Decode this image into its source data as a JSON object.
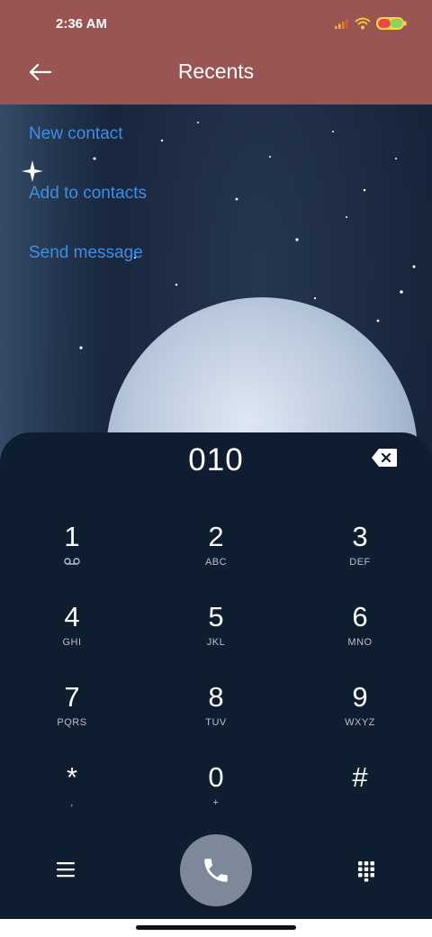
{
  "status_bar": {
    "time": "2:36 AM"
  },
  "header": {
    "title": "Recents",
    "back_icon": "arrow-left-icon"
  },
  "actions": [
    {
      "label": "New contact"
    },
    {
      "label": "Add to contacts"
    },
    {
      "label": "Send message"
    }
  ],
  "dialer": {
    "number": "010",
    "keys": [
      {
        "digit": "1",
        "letters": ""
      },
      {
        "digit": "2",
        "letters": "ABC"
      },
      {
        "digit": "3",
        "letters": "DEF"
      },
      {
        "digit": "4",
        "letters": "GHI"
      },
      {
        "digit": "5",
        "letters": "JKL"
      },
      {
        "digit": "6",
        "letters": "MNO"
      },
      {
        "digit": "7",
        "letters": "PQRS"
      },
      {
        "digit": "8",
        "letters": "TUV"
      },
      {
        "digit": "9",
        "letters": "WXYZ"
      },
      {
        "digit": "*",
        "letters": ","
      },
      {
        "digit": "0",
        "letters": "+"
      },
      {
        "digit": "#",
        "letters": ""
      }
    ]
  },
  "colors": {
    "header_bg": "#9a5552",
    "link": "#3b8fe8",
    "dialer_bg": "#0e1d2f",
    "call_button": "#7d8898"
  },
  "icons": {
    "voicemail": "voicemail-icon",
    "backspace": "backspace-icon",
    "menu": "menu-icon",
    "call": "phone-icon",
    "dialpad": "dialpad-icon"
  }
}
